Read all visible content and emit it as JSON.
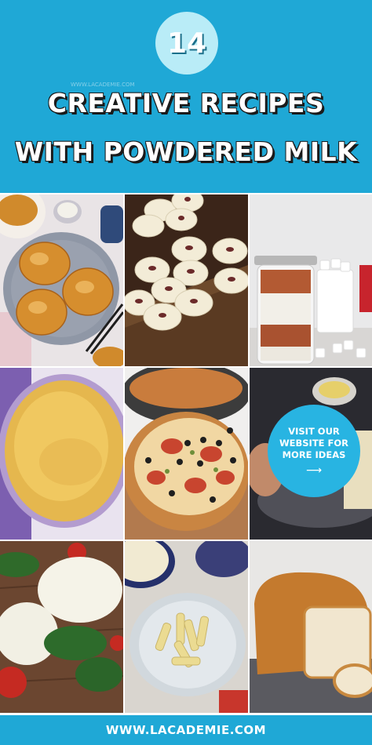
{
  "header": {
    "number": "14",
    "title_line1": "CREATIVE RECIPES",
    "title_line2": "WITH POWDERED MILK",
    "watermark": "WWW.LACADEMIE.COM"
  },
  "tiles": [
    {
      "name": "milk-bread-rolls",
      "icon": "bread-rolls-photo"
    },
    {
      "name": "milk-peda-sweets",
      "icon": "sweets-photo"
    },
    {
      "name": "hot-cocoa-jar",
      "icon": "jar-photo"
    },
    {
      "name": "custard-pie",
      "icon": "pie-photo"
    },
    {
      "name": "pizza",
      "icon": "pizza-photo"
    },
    {
      "name": "milk-candy",
      "icon": "candy-photo"
    },
    {
      "name": "mozzarella-cheese",
      "icon": "cheese-photo"
    },
    {
      "name": "milk-candy-sticks",
      "icon": "candy-sticks-photo"
    },
    {
      "name": "milk-bread-loaf",
      "icon": "bread-loaf-photo"
    }
  ],
  "cta": {
    "text": "VISIT OUR WEBSITE FOR MORE IDEAS",
    "arrow": "⟶"
  },
  "footer": {
    "url": "WWW.LACADEMIE.COM"
  },
  "colors": {
    "brand": "#1fa8d6",
    "badge": "#b9ecf7",
    "cta": "#28b4e2"
  }
}
